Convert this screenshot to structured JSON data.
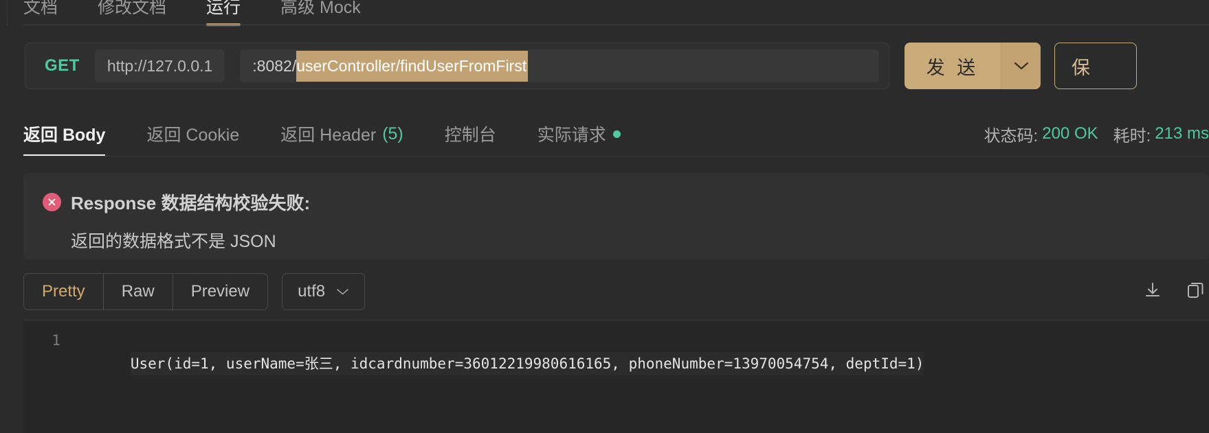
{
  "top_tabs": [
    {
      "label": "文档",
      "active": false
    },
    {
      "label": "修改文档",
      "active": false
    },
    {
      "label": "运行",
      "active": true
    },
    {
      "label": "高级 Mock",
      "active": false
    }
  ],
  "request": {
    "method": "GET",
    "host": "http://127.0.0.1",
    "path_prefix": ":8082/",
    "path_selected": "userController/findUserFromFirst",
    "send_label": "发 送",
    "send_caret_icon": "chevron-down-icon",
    "save_label": "保",
    "accent_color": "#c9ab79",
    "method_color": "#4ec9a0"
  },
  "response_tabs": [
    {
      "label": "返回 Body",
      "active": true,
      "count": "",
      "dot": false
    },
    {
      "label": "返回 Cookie",
      "active": false,
      "count": "",
      "dot": false
    },
    {
      "label": "返回 Header",
      "active": false,
      "count": "(5)",
      "dot": false
    },
    {
      "label": "控制台",
      "active": false,
      "count": "",
      "dot": false
    },
    {
      "label": "实际请求",
      "active": false,
      "count": "",
      "dot": true
    }
  ],
  "status": {
    "code_label": "状态码:",
    "code_value": "200 OK",
    "time_label": "耗时:",
    "time_value": "213 ms",
    "ok_color": "#4ec9a0"
  },
  "error": {
    "icon": "error-circle-x-icon",
    "icon_color": "#e25c78",
    "title": "Response 数据结构校验失败:",
    "detail": "返回的数据格式不是 JSON"
  },
  "format_bar": {
    "segments": [
      {
        "label": "Pretty",
        "active": true
      },
      {
        "label": "Raw",
        "active": false
      },
      {
        "label": "Preview",
        "active": false
      }
    ],
    "encoding": "utf8",
    "encoding_caret_icon": "chevron-down-icon",
    "active_color": "#d3aa6d",
    "actions": [
      {
        "name": "download-icon"
      },
      {
        "name": "copy-icon"
      }
    ]
  },
  "body": {
    "lines": [
      {
        "number": "1",
        "text": "User(id=1, userName=张三, idcardnumber=36012219980616165, phoneNumber=13970054754, deptId=1)"
      }
    ]
  }
}
